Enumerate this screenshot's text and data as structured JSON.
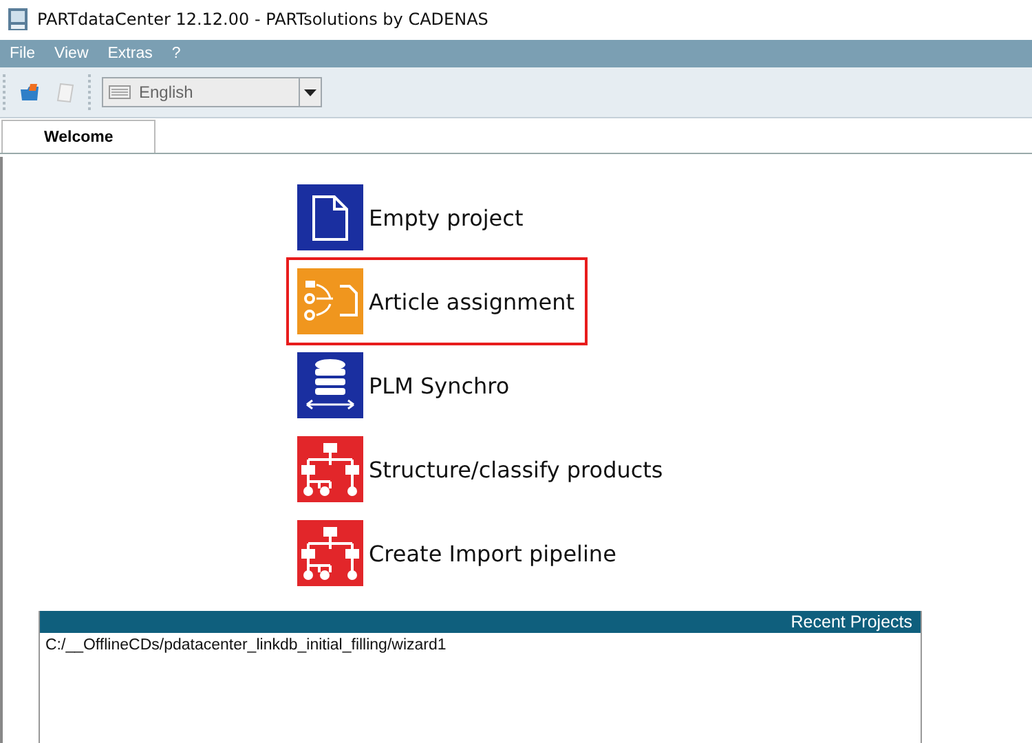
{
  "window": {
    "title": "PARTdataCenter 12.12.00 - PARTsolutions by CADENAS"
  },
  "menu": [
    "File",
    "View",
    "Extras",
    "?"
  ],
  "toolbar": {
    "language": "English"
  },
  "tabs": [
    {
      "label": "Welcome",
      "selected": true
    }
  ],
  "actions": [
    {
      "kind": "document",
      "label": "Empty project",
      "highlighted": false
    },
    {
      "kind": "assignment",
      "label": "Article assignment",
      "highlighted": true
    },
    {
      "kind": "database",
      "label": "PLM Synchro",
      "highlighted": false
    },
    {
      "kind": "structure",
      "label": "Structure/classify products",
      "highlighted": false
    },
    {
      "kind": "structure",
      "label": "Create Import pipeline",
      "highlighted": false
    }
  ],
  "recent_projects": {
    "title": "Recent Projects",
    "items": [
      "C:/__OfflineCDs/pdatacenter_linkdb_initial_filling/wizard1"
    ]
  }
}
